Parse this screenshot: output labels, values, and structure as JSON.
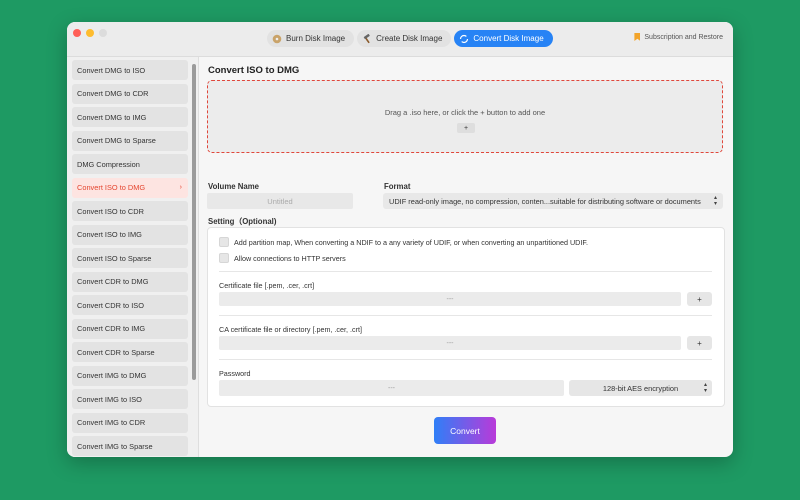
{
  "tabs": [
    {
      "label": "Burn Disk Image",
      "icon": "disc-icon"
    },
    {
      "label": "Create Disk Image",
      "icon": "hammer-icon"
    },
    {
      "label": "Convert Disk Image",
      "icon": "convert-icon"
    }
  ],
  "subscription_label": "Subscription and Restore",
  "sidebar": {
    "items": [
      "Convert DMG to ISO",
      "Convert DMG to CDR",
      "Convert DMG to IMG",
      "Convert DMG to Sparse",
      "DMG Compression",
      "Convert ISO to DMG",
      "Convert ISO to CDR",
      "Convert ISO to IMG",
      "Convert ISO to Sparse",
      "Convert CDR to DMG",
      "Convert CDR to ISO",
      "Convert CDR to IMG",
      "Convert CDR to Sparse",
      "Convert IMG to DMG",
      "Convert IMG to ISO",
      "Convert IMG to CDR",
      "Convert IMG to Sparse"
    ],
    "active_chevron": "›"
  },
  "main": {
    "title": "Convert ISO to DMG",
    "drop_text": "Drag a .iso here, or click the + button to add one",
    "drop_add": "+",
    "volume_label": "Volume Name",
    "volume_placeholder": "Untitled",
    "format_label": "Format",
    "format_value": "UDIF read-only image, no compression, conten...suitable for distributing software or documents",
    "setting_label": "Setting（Optional)",
    "check_partition": "Add partition map, When converting a NDIF to a any variety of UDIF, or when converting an unpartitioned UDIF.",
    "check_http": "Allow connections to HTTP servers",
    "cert_label": "Certificate file [.pem, .cer, .crt]",
    "cert_value": "---",
    "ca_label": "CA certificate file or directory [.pem, .cer, .crt]",
    "ca_value": "---",
    "password_label": "Password",
    "password_value": "---",
    "encryption_value": "128-bit AES encryption",
    "plus": "+",
    "convert_label": "Convert"
  },
  "colors": {
    "accent": "#2783f5",
    "active_item": "#e5452f",
    "background": "#1e9a63"
  }
}
